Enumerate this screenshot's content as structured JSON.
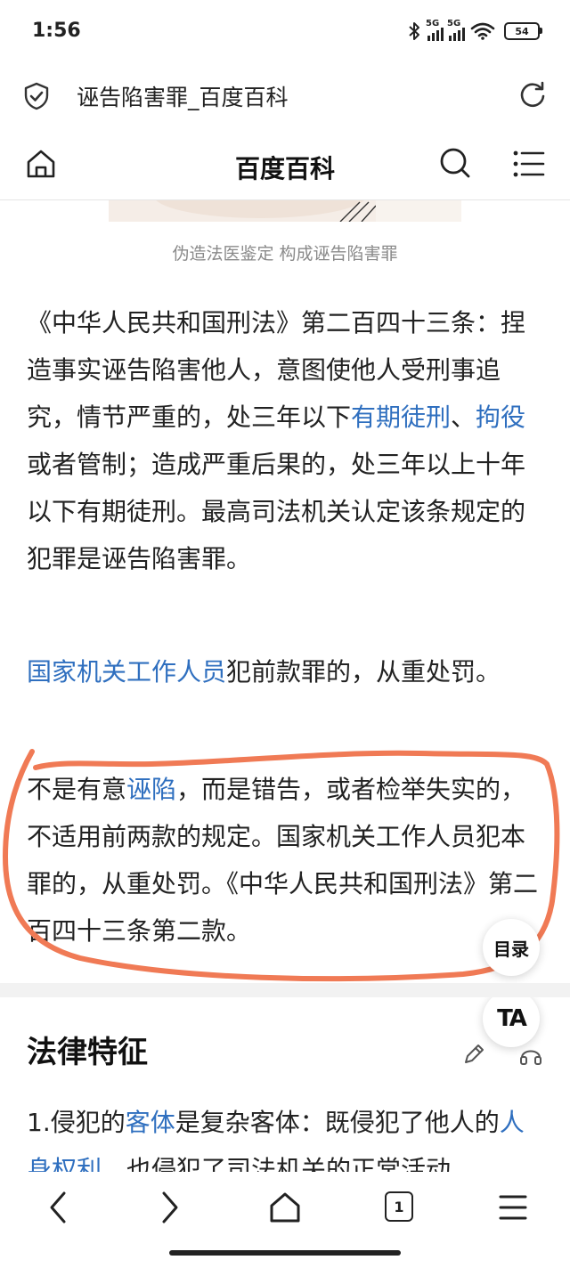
{
  "status": {
    "time": "1:56",
    "network": "5G",
    "battery": "54"
  },
  "browser": {
    "page_title": "诬告陷害罪_百度百科"
  },
  "site": {
    "name": "百度百科"
  },
  "image_caption": "伪造法医鉴定 构成诬告陷害罪",
  "para1": {
    "s1": "《中华人民共和国刑法》第二百四十三条：捏造事实诬告陷害他人，意图使他人受刑事追究，情节严重的，处三年以下",
    "link1": "有期徒刑",
    "sep": "、",
    "link2": "拘役",
    "s2": "或者管制；造成严重后果的，处三年以上十年以下有期徒刑。最高司法机关认定该条规定的犯罪是诬告陷害罪。"
  },
  "para2": {
    "link": "国家机关工作人员",
    "text": "犯前款罪的，从重处罚。"
  },
  "para3": {
    "s1": "不是有意",
    "link": "诬陷",
    "s2": "，而是错告，或者检举失实的，不适用前两款的规定。国家机关工作人员犯本罪的，从重处罚。《中华人民共和国刑法》第二百四十三条第二款。"
  },
  "fab": {
    "toc": "目录",
    "ta": "TA"
  },
  "section": {
    "title": "法律特征"
  },
  "para4": {
    "s1": "1.侵犯的",
    "link1": "客体",
    "s2": "是复杂客体：既侵犯了他人的",
    "link2": "人身权利",
    "s3": "，也侵犯了司法机关的正常活动。"
  },
  "nav": {
    "tab_count": "1"
  },
  "colors": {
    "link": "#2f6fbf",
    "annotation": "#f07a55"
  }
}
